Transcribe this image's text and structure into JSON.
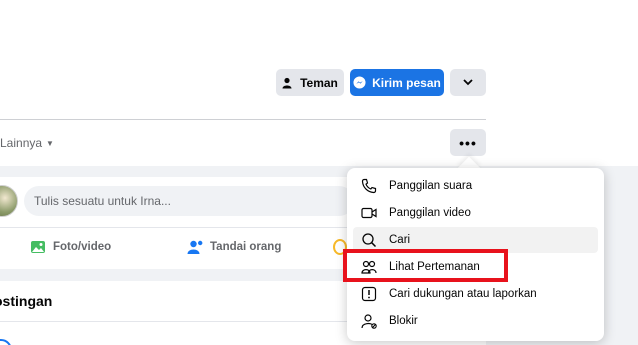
{
  "header": {
    "friends_label": "Teman",
    "message_label": "Kirim pesan",
    "tab_more_label": "Lainnya",
    "more_options_label": "•••"
  },
  "composer": {
    "placeholder": "Tulis sesuatu untuk Irna...",
    "photo_label": "Foto/video",
    "tag_label": "Tandai orang"
  },
  "posts": {
    "title": "ostingan"
  },
  "menu": {
    "items": [
      {
        "label": "Panggilan suara",
        "icon": "phone-icon"
      },
      {
        "label": "Panggilan video",
        "icon": "video-camera-icon"
      },
      {
        "label": "Cari",
        "icon": "search-icon"
      },
      {
        "label": "Lihat Pertemanan",
        "icon": "friendship-icon"
      },
      {
        "label": "Cari dukungan atau laporkan",
        "icon": "report-icon"
      },
      {
        "label": "Blokir",
        "icon": "block-user-icon"
      }
    ]
  },
  "colors": {
    "brand_blue": "#1b74e4",
    "highlight_red": "#e8121c"
  }
}
